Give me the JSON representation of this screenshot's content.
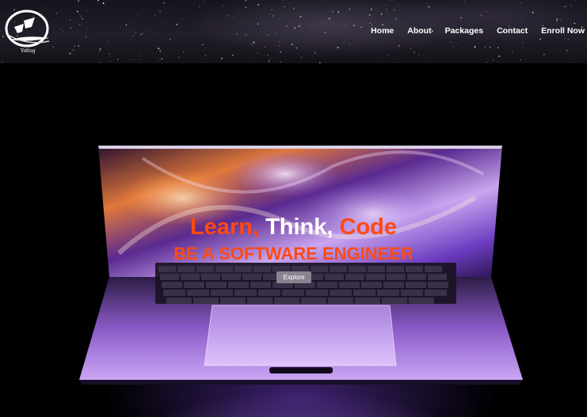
{
  "header": {
    "logo_text": "Yolteg",
    "nav": [
      {
        "label": "Home"
      },
      {
        "label": "About"
      },
      {
        "label": "Packages"
      },
      {
        "label": "Contact"
      },
      {
        "label": "Enroll Now"
      }
    ]
  },
  "hero": {
    "headline": {
      "word1": "Learn,",
      "word2": "Think,",
      "word3": "Code"
    },
    "subheadline": "BE A SOFTWARE ENGINEER",
    "cta_label": "Explore"
  },
  "colors": {
    "accent": "#ff4a12",
    "nav_text": "#ffffff",
    "background": "#000000",
    "button_bg": "#8a8290"
  }
}
